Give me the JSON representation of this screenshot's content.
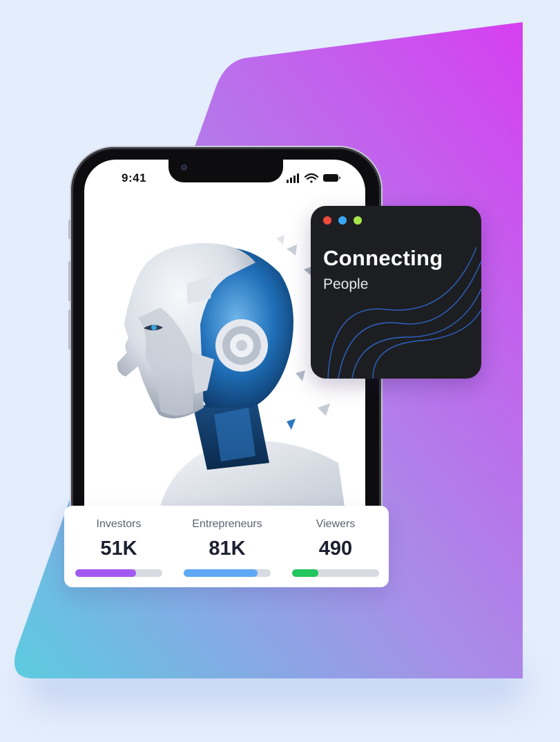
{
  "phone": {
    "status_time": "9:41",
    "status_icons": [
      "signal-icon",
      "wifi-icon",
      "battery-icon"
    ]
  },
  "hero_image": "robot-head-illustration",
  "connect_card": {
    "title": "Connecting",
    "subtitle": "People",
    "window_dots": [
      "#ee4a3c",
      "#3aa6f2",
      "#a7e64a"
    ]
  },
  "stats": [
    {
      "label": "Investors",
      "value": "51K",
      "progress": 0.7,
      "color": "#a259f0"
    },
    {
      "label": "Entrepreneurs",
      "value": "81K",
      "progress": 0.85,
      "color": "#5fa8f5"
    },
    {
      "label": "Viewers",
      "value": "490",
      "progress": 0.3,
      "color": "#22c55e"
    }
  ],
  "colors": {
    "page_background": "#e3edfc",
    "gradient_start": "#5ccbe0",
    "gradient_mid": "#a88ee8",
    "gradient_end": "#d63ff0",
    "card_dark": "#1d1e21"
  }
}
